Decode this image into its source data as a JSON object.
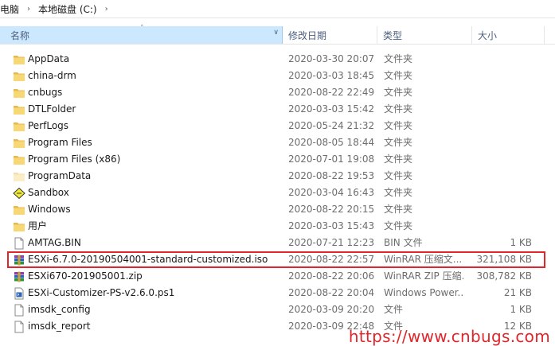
{
  "breadcrumb": {
    "items": [
      "电脑",
      "本地磁盘 (C:)"
    ]
  },
  "columns": {
    "name": "名称",
    "date": "修改日期",
    "type": "类型",
    "size": "大小"
  },
  "files": [
    {
      "name": "AppData",
      "date": "2020-03-30 20:07",
      "type": "文件夹",
      "size": "",
      "icon": "folder-icon"
    },
    {
      "name": "china-drm",
      "date": "2020-03-03 18:45",
      "type": "文件夹",
      "size": "",
      "icon": "folder-icon"
    },
    {
      "name": "cnbugs",
      "date": "2020-08-22 22:49",
      "type": "文件夹",
      "size": "",
      "icon": "folder-icon"
    },
    {
      "name": "DTLFolder",
      "date": "2020-03-03 15:42",
      "type": "文件夹",
      "size": "",
      "icon": "folder-icon"
    },
    {
      "name": "PerfLogs",
      "date": "2020-05-24 21:32",
      "type": "文件夹",
      "size": "",
      "icon": "folder-icon"
    },
    {
      "name": "Program Files",
      "date": "2020-08-05 18:44",
      "type": "文件夹",
      "size": "",
      "icon": "folder-icon"
    },
    {
      "name": "Program Files (x86)",
      "date": "2020-07-01 19:08",
      "type": "文件夹",
      "size": "",
      "icon": "folder-icon"
    },
    {
      "name": "ProgramData",
      "date": "2020-08-22 19:53",
      "type": "文件夹",
      "size": "",
      "icon": "folder-hidden-icon"
    },
    {
      "name": "Sandbox",
      "date": "2020-03-04 16:43",
      "type": "文件夹",
      "size": "",
      "icon": "sandbox-folder-icon"
    },
    {
      "name": "Windows",
      "date": "2020-08-22 20:15",
      "type": "文件夹",
      "size": "",
      "icon": "folder-icon"
    },
    {
      "name": "用户",
      "date": "2020-03-03 15:43",
      "type": "文件夹",
      "size": "",
      "icon": "folder-icon"
    },
    {
      "name": "AMTAG.BIN",
      "date": "2020-07-21 12:23",
      "type": "BIN 文件",
      "size": "1 KB",
      "icon": "file-icon"
    },
    {
      "name": "ESXi-6.7.0-20190504001-standard-customized.iso",
      "date": "2020-08-22 22:57",
      "type": "WinRAR 压缩文...",
      "size": "321,108 KB",
      "icon": "winrar-icon"
    },
    {
      "name": "ESXi670-201905001.zip",
      "date": "2020-08-22 20:06",
      "type": "WinRAR ZIP 压缩...",
      "size": "308,782 KB",
      "icon": "winrar-icon"
    },
    {
      "name": "ESXi-Customizer-PS-v2.6.0.ps1",
      "date": "2020-08-22 20:04",
      "type": "Windows Power...",
      "size": "21 KB",
      "icon": "powershell-script-icon"
    },
    {
      "name": "imsdk_config",
      "date": "2020-03-09 20:20",
      "type": "文件",
      "size": "1 KB",
      "icon": "file-icon"
    },
    {
      "name": "imsdk_report",
      "date": "2020-03-09 22:48",
      "type": "文件",
      "size": "12 KB",
      "icon": "file-icon"
    }
  ],
  "highlighted_row_index": 12,
  "watermark": "https://www.cnbugs.com",
  "colors": {
    "header_selected": "#cce8ff",
    "folder": "#f8d775",
    "highlight": "#e0252b",
    "watermark": "#e0252b"
  }
}
